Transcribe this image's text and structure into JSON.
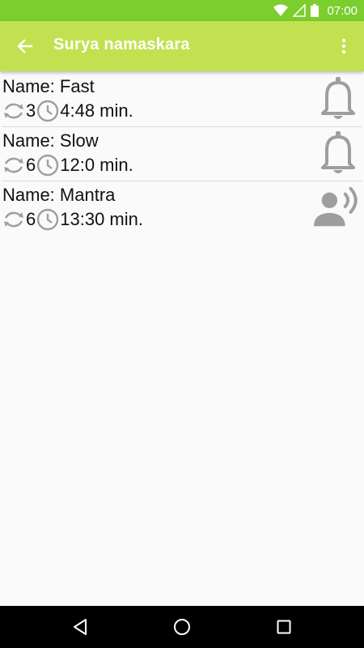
{
  "status_bar": {
    "time": "07:00",
    "icons": [
      "wifi-icon",
      "signal-icon",
      "battery-icon"
    ]
  },
  "app_bar": {
    "title": "Surya namaskara",
    "back_icon": "arrow-back-icon",
    "menu_icon": "overflow-menu-icon",
    "color": "#c2e150",
    "status_color": "#7ccd2e"
  },
  "items": [
    {
      "name": "Name: Fast",
      "repeats": "3",
      "duration": "4:48 min.",
      "action_icon": "bell-icon"
    },
    {
      "name": "Name: Slow",
      "repeats": "6",
      "duration": "12:0 min.",
      "action_icon": "bell-icon"
    },
    {
      "name": "Name: Mantra",
      "repeats": "6",
      "duration": "13:30 min.",
      "action_icon": "voice-icon"
    }
  ],
  "nav_bar": {
    "buttons": [
      "back-triangle-icon",
      "home-circle-icon",
      "recents-square-icon"
    ]
  }
}
